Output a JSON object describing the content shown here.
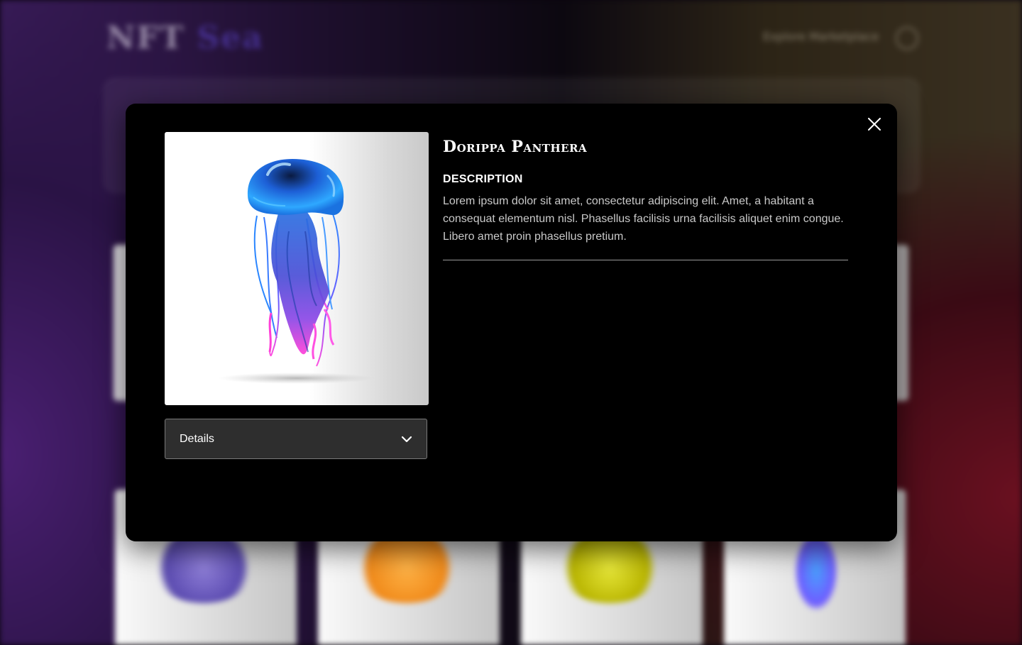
{
  "background": {
    "logo_main": "NFT",
    "logo_accent": "Sea",
    "nav_link": "Explore Marketplace"
  },
  "modal": {
    "title": "Dorippa Panthera",
    "description_heading": "DESCRIPTION",
    "description_text": "Lorem ipsum dolor sit amet, consectetur adipiscing elit. Amet, a habitant a consequat elementum nisl. Phasellus facilisis urna facilisis aliquet enim congue. Libero amet proin phasellus pretium.",
    "details_label": "Details",
    "image_alt": "jellyfish",
    "icons": {
      "close": "close-icon",
      "dropdown": "chevron-down-icon"
    }
  },
  "colors": {
    "modal_bg": "#000000",
    "dropdown_bg": "#2e2e2e",
    "accent_purple": "#5a43c9"
  }
}
